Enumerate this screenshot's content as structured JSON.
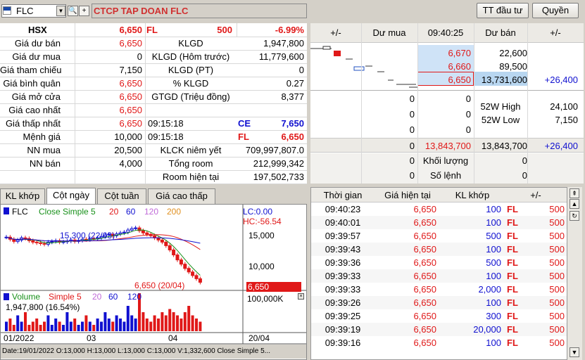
{
  "toolbar": {
    "symbol": "FLC",
    "company": "CTCP TAP DOAN FLC",
    "btn_invest": "TT đầu tư",
    "btn_rights": "Quyền"
  },
  "summary": {
    "exchange": "HSX",
    "price": "6,650",
    "code": "FL",
    "vol": "500",
    "pct": "-6.99%"
  },
  "info_left": [
    {
      "label": "",
      "value": ""
    },
    {
      "label": "Giá dư bán",
      "value": "6,650"
    },
    {
      "label": "Giá dư mua",
      "value": "0"
    },
    {
      "label": "Giá tham chiếu",
      "value": "7,150"
    },
    {
      "label": "Giá bình quân",
      "value": "6,650"
    },
    {
      "label": "Giá mở cửa",
      "value": "6,650"
    },
    {
      "label": "Giá cao nhất",
      "value": "6,650"
    },
    {
      "label": "Giá thấp nhất",
      "value": "6,650"
    },
    {
      "label": "Mệnh giá",
      "value": "10,000"
    },
    {
      "label": "NN mua",
      "value": "20,500"
    },
    {
      "label": "NN bán",
      "value": "4,000"
    }
  ],
  "info_right": [
    {
      "label": "KLGD",
      "value": "1,947,800"
    },
    {
      "label": "KLGD (Hôm trước)",
      "value": "11,779,600"
    },
    {
      "label": "KLGD (PT)",
      "value": "0"
    },
    {
      "label": "% KLGD",
      "value": "0.27"
    },
    {
      "label": "GTGD (Triệu đồng)",
      "value": "8,377"
    }
  ],
  "time_high": {
    "time": "09:15:18",
    "code": "CE",
    "price": "7,650"
  },
  "time_low": {
    "time": "09:15:18",
    "code": "FL",
    "price": "6,650"
  },
  "info_bottom": [
    {
      "label": "KLCK niêm yết",
      "value": "709,997,807.0"
    },
    {
      "label": "Tổng room",
      "value": "212,999,342"
    },
    {
      "label": "Room hiện tại",
      "value": "197,502,733"
    }
  ],
  "book": {
    "headers": [
      "+/-",
      "Dư mua",
      "09:40:25",
      "Dư bán",
      "+/-"
    ],
    "asks": [
      {
        "price": "6,670",
        "vol": "22,600",
        "chg": ""
      },
      {
        "price": "6,660",
        "vol": "89,500",
        "chg": ""
      },
      {
        "price": "6,650",
        "vol": "13,731,600",
        "chg": "+26,400"
      }
    ],
    "bids": [
      {
        "vol": "0",
        "price": "0"
      },
      {
        "vol": "0",
        "price": "0"
      },
      {
        "vol": "0",
        "price": "0"
      }
    ],
    "w52_high_label": "52W High",
    "w52_high": "24,100",
    "w52_low_label": "52W Low",
    "w52_low": "7,150",
    "total_bid": "0",
    "total_mid": "13,843,700",
    "total_ask": "13,843,700",
    "total_chg": "+26,400",
    "match_vol_label": "Khối lượng",
    "match_vol_left": "0",
    "match_vol_right": "0",
    "orders_label": "Số lệnh",
    "orders_left": "0",
    "orders_right": "0"
  },
  "tabs": [
    "KL khớp",
    "Cột ngày",
    "Cột tuần",
    "Giá cao thấp"
  ],
  "chart": {
    "legend_symbol": "FLC",
    "legend_close": "Close Simple 5",
    "ma": [
      "20",
      "60",
      "120",
      "200"
    ],
    "lc": "LC:0.00",
    "hc": "HC:-56.54",
    "y_ticks": [
      "15,000",
      "10,000"
    ],
    "high_label": "15,300 (22/03)",
    "low_label": "6,650 (20/04)",
    "last_price": "6,650",
    "vol_legend": "Volume",
    "vol_simple": "Simple 5",
    "vol_ma": [
      "20",
      "60",
      "120"
    ],
    "vol_value": "1,947,800 (16.54%)",
    "vol_tick": "100,000K",
    "x_labels": [
      "01/2022",
      "03",
      "04",
      "20/04"
    ],
    "status": "Date:19/01/2022 O:13,000 H:13,000 L:13,000 C:13,000 V:1,332,600 Close Simple 5..."
  },
  "trades": {
    "headers": [
      "Thời gian",
      "Giá hiện tại",
      "KL khớp",
      "+/-"
    ],
    "rows": [
      {
        "t": "09:40:23",
        "p": "6,650",
        "v": "100",
        "c": "FL",
        "d": "500"
      },
      {
        "t": "09:40:01",
        "p": "6,650",
        "v": "100",
        "c": "FL",
        "d": "500"
      },
      {
        "t": "09:39:57",
        "p": "6,650",
        "v": "500",
        "c": "FL",
        "d": "500"
      },
      {
        "t": "09:39:43",
        "p": "6,650",
        "v": "100",
        "c": "FL",
        "d": "500"
      },
      {
        "t": "09:39:36",
        "p": "6,650",
        "v": "500",
        "c": "FL",
        "d": "500"
      },
      {
        "t": "09:39:33",
        "p": "6,650",
        "v": "100",
        "c": "FL",
        "d": "500"
      },
      {
        "t": "09:39:33",
        "p": "6,650",
        "v": "2,000",
        "c": "FL",
        "d": "500"
      },
      {
        "t": "09:39:26",
        "p": "6,650",
        "v": "100",
        "c": "FL",
        "d": "500"
      },
      {
        "t": "09:39:25",
        "p": "6,650",
        "v": "300",
        "c": "FL",
        "d": "500"
      },
      {
        "t": "09:39:19",
        "p": "6,650",
        "v": "20,000",
        "c": "FL",
        "d": "500"
      },
      {
        "t": "09:39:16",
        "p": "6,650",
        "v": "100",
        "c": "FL",
        "d": "500"
      }
    ]
  },
  "colors": {
    "red": "#e01818",
    "blue": "#1010d0",
    "highlight": "#cfe3f7"
  }
}
